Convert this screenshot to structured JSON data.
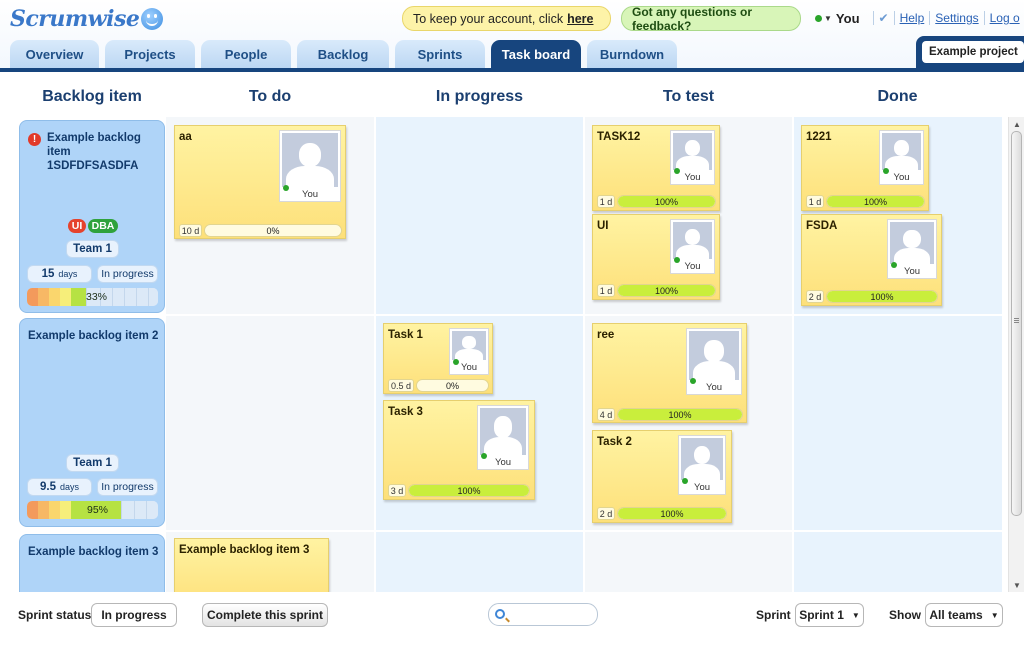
{
  "app": {
    "logo_text": "Scrumwise"
  },
  "notices": {
    "account_text": "To keep your account, click",
    "account_link": "here",
    "feedback": "Got any questions or feedback?"
  },
  "user": {
    "name": "You",
    "help": "Help",
    "settings": "Settings",
    "logout": "Log o"
  },
  "tabs": [
    {
      "label": "Overview"
    },
    {
      "label": "Projects"
    },
    {
      "label": "People"
    },
    {
      "label": "Backlog"
    },
    {
      "label": "Sprints"
    },
    {
      "label": "Task board",
      "active": true
    },
    {
      "label": "Burndown"
    }
  ],
  "project_selector": {
    "value": "Example project"
  },
  "columns": [
    "Backlog item",
    "To do",
    "In progress",
    "To test",
    "Done"
  ],
  "backlog_items": [
    {
      "title": "Example backlog item 1SDFDFSASDFA",
      "tags": [
        "UI",
        "DBA"
      ],
      "team": "Team 1",
      "days": "15",
      "days_unit": "days",
      "status": "In progress",
      "progress_label": "33%",
      "progress": 0.33
    },
    {
      "title": "Example backlog item 2",
      "team": "Team 1",
      "days": "9.5",
      "days_unit": "days",
      "status": "In progress",
      "progress_label": "95%",
      "progress": 0.95
    },
    {
      "title": "Example backlog item 3"
    }
  ],
  "tasks": {
    "aa": {
      "title": "aa",
      "owner": "You",
      "estimate": "10 d",
      "progress_label": "0%",
      "progress": 0
    },
    "task12": {
      "title": "TASK12",
      "owner": "You",
      "estimate": "1 d",
      "progress_label": "100%",
      "progress": 1
    },
    "ui": {
      "title": "UI",
      "owner": "You",
      "estimate": "1 d",
      "progress_label": "100%",
      "progress": 1
    },
    "t1221": {
      "title": "1221",
      "owner": "You",
      "estimate": "1 d",
      "progress_label": "100%",
      "progress": 1
    },
    "fsda": {
      "title": "FSDA",
      "owner": "You",
      "estimate": "2 d",
      "progress_label": "100%",
      "progress": 1
    },
    "task1": {
      "title": "Task 1",
      "owner": "You",
      "estimate": "0.5 d",
      "progress_label": "0%",
      "progress": 0
    },
    "task3": {
      "title": "Task 3",
      "owner": "You",
      "estimate": "3 d",
      "progress_label": "100%",
      "progress": 1
    },
    "ree": {
      "title": "ree",
      "owner": "You",
      "estimate": "4 d",
      "progress_label": "100%",
      "progress": 1
    },
    "task2": {
      "title": "Task 2",
      "owner": "You",
      "estimate": "2 d",
      "progress_label": "100%",
      "progress": 1
    },
    "bi3": {
      "title": "Example backlog item 3"
    }
  },
  "footer": {
    "sprint_status_label": "Sprint status",
    "sprint_status_value": "In progress",
    "complete_button": "Complete this sprint",
    "search_placeholder": "",
    "sprint_label": "Sprint",
    "sprint_value": "Sprint 1",
    "show_label": "Show",
    "show_value": "All teams"
  },
  "colors": {
    "nav_dark": "#17457e",
    "backlog_card": "#afd4f8",
    "task_card": "#fde07a",
    "progress_green": "#c9ee3c",
    "tag_ui": "#e5432d",
    "tag_dba": "#2fa23c",
    "online": "#2aa52a"
  },
  "icons": [
    "smiley-logo-icon",
    "status-dot-icon",
    "checkmark-icon",
    "warning-icon",
    "avatar-icon",
    "search-icon",
    "chevron-down-icon"
  ]
}
